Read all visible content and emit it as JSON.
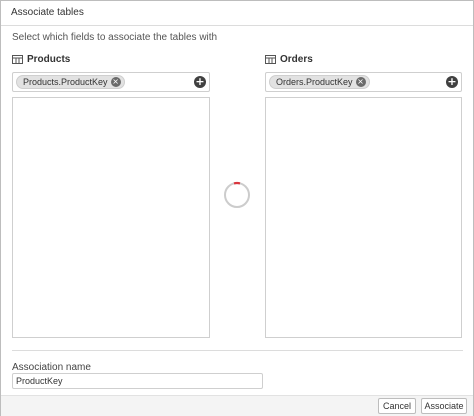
{
  "dialog": {
    "title": "Associate tables",
    "instructions": "Select which fields to associate the tables with"
  },
  "left_table": {
    "name": "Products",
    "icon": "table-icon",
    "selected_field": "Products.ProductKey"
  },
  "right_table": {
    "name": "Orders",
    "icon": "table-icon",
    "selected_field": "Orders.ProductKey"
  },
  "association": {
    "label": "Association name",
    "value": "ProductKey"
  },
  "footer": {
    "cancel_label": "Cancel",
    "associate_label": "Associate"
  },
  "colors": {
    "spinner_accent": "#d9363e",
    "spinner_track": "#cccccc"
  }
}
